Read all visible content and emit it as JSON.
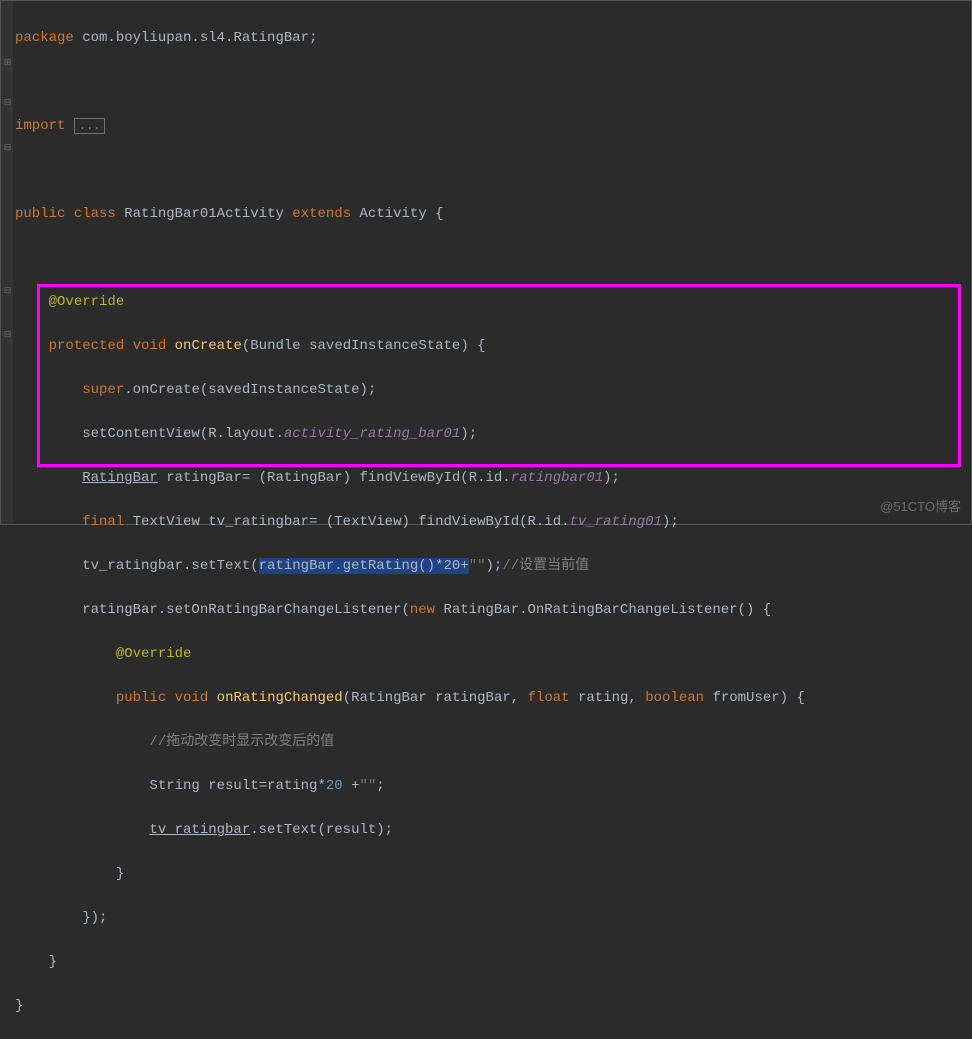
{
  "package_line": {
    "kw_package": "package",
    "pkg": " com.boyliupan.sl4.RatingBar",
    "semi": ";"
  },
  "import_line": {
    "kw_import": "import",
    "fold": "..."
  },
  "class_decl": {
    "kw_public": "public",
    "kw_class": "class",
    "name": "RatingBar01Activity",
    "kw_extends": "extends",
    "parent": "Activity",
    "brace": "{"
  },
  "override1": "@Override",
  "oncreate": {
    "kw_protected": "protected",
    "kw_void": "void",
    "name": "onCreate",
    "p_type": "Bundle",
    "p_name": "savedInstanceState",
    "brace": ") {"
  },
  "l1": {
    "pre": "super",
    "dot": ".onCreate(savedInstanceState);"
  },
  "l2": {
    "pre": "setContentView(R.layout.",
    "field": "activity_rating_bar01",
    "tail": ");"
  },
  "l3": {
    "type": "RatingBar",
    "var": " ratingBar= (RatingBar) findViewById(R.id.",
    "field": "ratingbar01",
    "tail": ");"
  },
  "l4": {
    "kw": "final",
    "type": " TextView tv_ratingbar= (TextView) findViewById(R.id.",
    "field": "tv_rating01",
    "tail": ");"
  },
  "l5": {
    "pre": "tv_ratingbar.setText(",
    "sel": "ratingBar.getRating()*20",
    "plus": "+",
    "str": "\"\"",
    "paren": ")",
    "semi": ";",
    "comment": "//设置当前值"
  },
  "l6": {
    "pre": "ratingBar.setOnRatingBarChangeListener(",
    "kw_new": "new",
    "type": " RatingBar.OnRatingBarChangeListener() {"
  },
  "override2": "@Override",
  "l7": {
    "kw_public": "public",
    "kw_void": "void",
    "name": "onRatingChanged",
    "p1t": "RatingBar",
    "p1n": "ratingBar",
    "p2t": "float",
    "p2n": "rating",
    "p3t": "boolean",
    "p3n": "fromUser",
    "brace": ") {"
  },
  "l8": {
    "comment": "//拖动改变时显示改变后的值"
  },
  "l9": {
    "pre": "String result=rating*",
    "num": "20",
    "plus": " +",
    "str": "\"\"",
    "semi": ";"
  },
  "l10": {
    "var": "tv_ratingbar",
    "tail": ".setText(result);"
  },
  "close1": "}",
  "close2": "});",
  "close3": "}",
  "close4": "}",
  "watermark": "@51CTO博客"
}
